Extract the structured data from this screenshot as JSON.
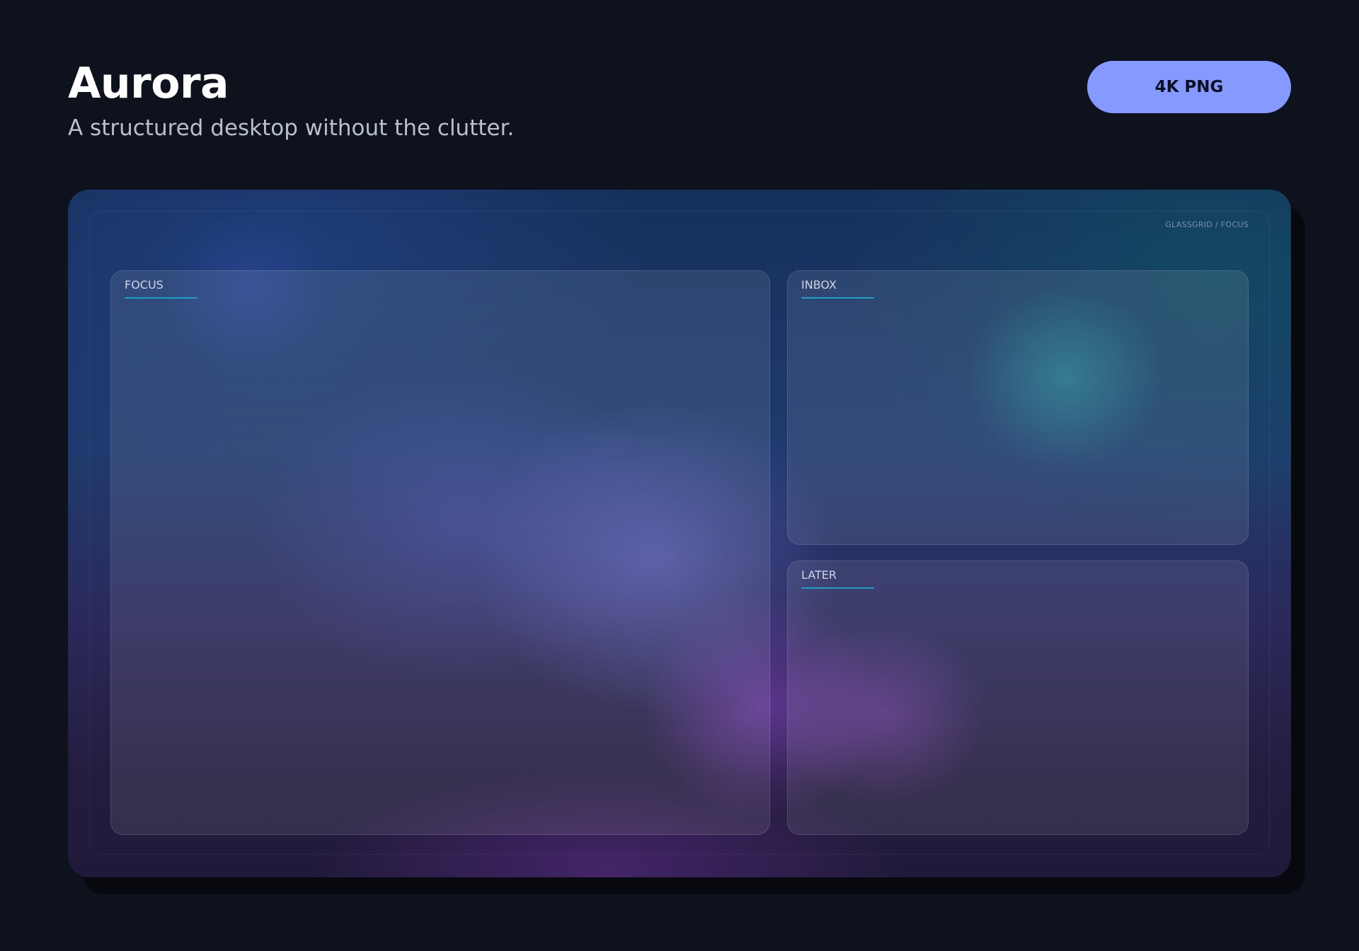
{
  "header": {
    "title": "Aurora",
    "subtitle": "A structured desktop without the clutter.",
    "badge_label": "4K PNG"
  },
  "desktop": {
    "brand_label": "GLASSGRID / FOCUS",
    "panels": [
      {
        "label": "FOCUS"
      },
      {
        "label": "INBOX"
      },
      {
        "label": "LATER"
      }
    ]
  },
  "colors": {
    "page_background": "#0e121c",
    "badge_background": "#8599ff",
    "panel_accent": "#1e9fc4"
  }
}
